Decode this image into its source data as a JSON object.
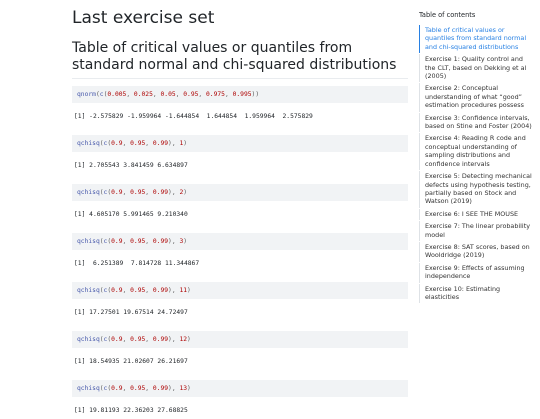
{
  "page": {
    "title": "Last exercise set",
    "section_title": "Table of critical values or quantiles from standard normal and chi-squared distributions"
  },
  "blocks": [
    {
      "code": {
        "fn": "qnorm",
        "args": [
          "0.005",
          "0.025",
          "0.05",
          "0.95",
          "0.975",
          "0.995"
        ],
        "extra": ""
      },
      "output": "[1] -2.575829 -1.959964 -1.644854  1.644854  1.959964  2.575829"
    },
    {
      "code": {
        "fn": "qchisq",
        "args": [
          "0.9",
          "0.95",
          "0.99"
        ],
        "extra": "1"
      },
      "output": "[1] 2.705543 3.841459 6.634897"
    },
    {
      "code": {
        "fn": "qchisq",
        "args": [
          "0.9",
          "0.95",
          "0.99"
        ],
        "extra": "2"
      },
      "output": "[1] 4.605170 5.991465 9.210340"
    },
    {
      "code": {
        "fn": "qchisq",
        "args": [
          "0.9",
          "0.95",
          "0.99"
        ],
        "extra": "3"
      },
      "output": "[1]  6.251389  7.814728 11.344867"
    },
    {
      "code": {
        "fn": "qchisq",
        "args": [
          "0.9",
          "0.95",
          "0.99"
        ],
        "extra": "11"
      },
      "output": "[1] 17.27501 19.67514 24.72497"
    },
    {
      "code": {
        "fn": "qchisq",
        "args": [
          "0.9",
          "0.95",
          "0.99"
        ],
        "extra": "12"
      },
      "output": "[1] 18.54935 21.02607 26.21697"
    },
    {
      "code": {
        "fn": "qchisq",
        "args": [
          "0.9",
          "0.95",
          "0.99"
        ],
        "extra": "13"
      },
      "output": "[1] 19.81193 22.36203 27.68825"
    }
  ],
  "toc": {
    "title": "Table of contents",
    "items": [
      "Table of critical values or quantiles from standard normal and chi-squared distributions",
      "Exercise 1: Quality control and the CLT, based on Dekking et al (2005)",
      "Exercise 2: Conceptual understanding of what “good” estimation procedures possess",
      "Exercise 3: Confidence intervals, based on Stine and Foster (2004)",
      "Exercise 4: Reading R code and conceptual understanding of sampling distributions and confidence intervals",
      "Exercise 5: Detecting mechanical defects using hypothesis testing, partially based on Stock and Watson (2019)",
      "Exercise 6: I SEE THE MOUSE",
      "Exercise 7: The linear probability model",
      "Exercise 8: SAT scores, based on Wooldridge (2019)",
      "Exercise 9: Effects of assuming independence",
      "Exercise 10: Estimating elasticities"
    ]
  }
}
